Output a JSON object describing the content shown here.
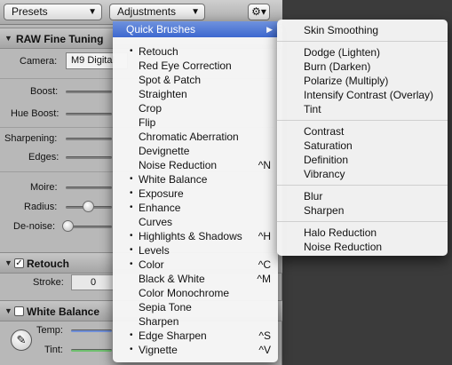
{
  "toolbar": {
    "presets_label": "Presets",
    "adjustments_label": "Adjustments",
    "gear_icon": "gear-icon"
  },
  "raw_section": {
    "title": "RAW Fine Tuning",
    "camera_label": "Camera:",
    "camera_value": "M9 Digital",
    "boost_label": "Boost:",
    "hue_boost_label": "Hue Boost:",
    "sharpening_label": "Sharpening:",
    "edges_label": "Edges:",
    "moire_label": "Moire:",
    "radius_label": "Radius:",
    "denoise_label": "De-noise:"
  },
  "retouch_section": {
    "title": "Retouch",
    "checked": true,
    "check_mark": "✓",
    "stroke_label": "Stroke:",
    "stroke_value": "0"
  },
  "white_balance_section": {
    "title": "White Balance",
    "checked": false,
    "temp_label": "Temp:",
    "tint_label": "Tint:"
  },
  "adjustments_menu": {
    "highlighted_item": "Quick Brushes",
    "items": [
      {
        "label": "Retouch",
        "bullet": "•",
        "shortcut": ""
      },
      {
        "label": "Red Eye Correction",
        "bullet": "",
        "shortcut": ""
      },
      {
        "label": "Spot & Patch",
        "bullet": "",
        "shortcut": ""
      },
      {
        "label": "Straighten",
        "bullet": "",
        "shortcut": ""
      },
      {
        "label": "Crop",
        "bullet": "",
        "shortcut": ""
      },
      {
        "label": "Flip",
        "bullet": "",
        "shortcut": ""
      },
      {
        "label": "Chromatic Aberration",
        "bullet": "",
        "shortcut": ""
      },
      {
        "label": "Devignette",
        "bullet": "",
        "shortcut": ""
      },
      {
        "label": "Noise Reduction",
        "bullet": "",
        "shortcut": "^N"
      },
      {
        "label": "White Balance",
        "bullet": "•",
        "shortcut": ""
      },
      {
        "label": "Exposure",
        "bullet": "•",
        "shortcut": ""
      },
      {
        "label": "Enhance",
        "bullet": "•",
        "shortcut": ""
      },
      {
        "label": "Curves",
        "bullet": "",
        "shortcut": ""
      },
      {
        "label": "Highlights & Shadows",
        "bullet": "•",
        "shortcut": "^H"
      },
      {
        "label": "Levels",
        "bullet": "•",
        "shortcut": ""
      },
      {
        "label": "Color",
        "bullet": "•",
        "shortcut": "^C"
      },
      {
        "label": "Black & White",
        "bullet": "",
        "shortcut": "^M"
      },
      {
        "label": "Color Monochrome",
        "bullet": "",
        "shortcut": ""
      },
      {
        "label": "Sepia Tone",
        "bullet": "",
        "shortcut": ""
      },
      {
        "label": "Sharpen",
        "bullet": "",
        "shortcut": ""
      },
      {
        "label": "Edge Sharpen",
        "bullet": "•",
        "shortcut": "^S"
      },
      {
        "label": "Vignette",
        "bullet": "•",
        "shortcut": "^V"
      }
    ]
  },
  "quick_brushes_submenu": {
    "groups": [
      [
        "Skin Smoothing"
      ],
      [
        "Dodge (Lighten)",
        "Burn (Darken)",
        "Polarize (Multiply)",
        "Intensify Contrast (Overlay)",
        "Tint"
      ],
      [
        "Contrast",
        "Saturation",
        "Definition",
        "Vibrancy"
      ],
      [
        "Blur",
        "Sharpen"
      ],
      [
        "Halo Reduction",
        "Noise Reduction"
      ]
    ]
  },
  "colors": {
    "menu_highlight": "#3d68cf",
    "panel_background": "#b8b8b8"
  }
}
